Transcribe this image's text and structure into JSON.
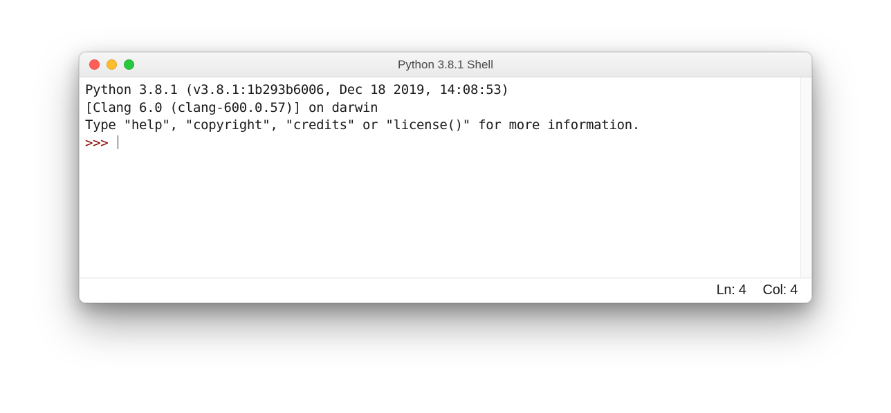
{
  "titlebar": {
    "title": "Python 3.8.1 Shell"
  },
  "shell": {
    "line1": "Python 3.8.1 (v3.8.1:1b293b6006, Dec 18 2019, 14:08:53) ",
    "line2": "[Clang 6.0 (clang-600.0.57)] on darwin",
    "line3": "Type \"help\", \"copyright\", \"credits\" or \"license()\" for more information.",
    "prompt": ">>> "
  },
  "statusbar": {
    "line_label": "Ln: 4",
    "col_label": "Col: 4"
  }
}
